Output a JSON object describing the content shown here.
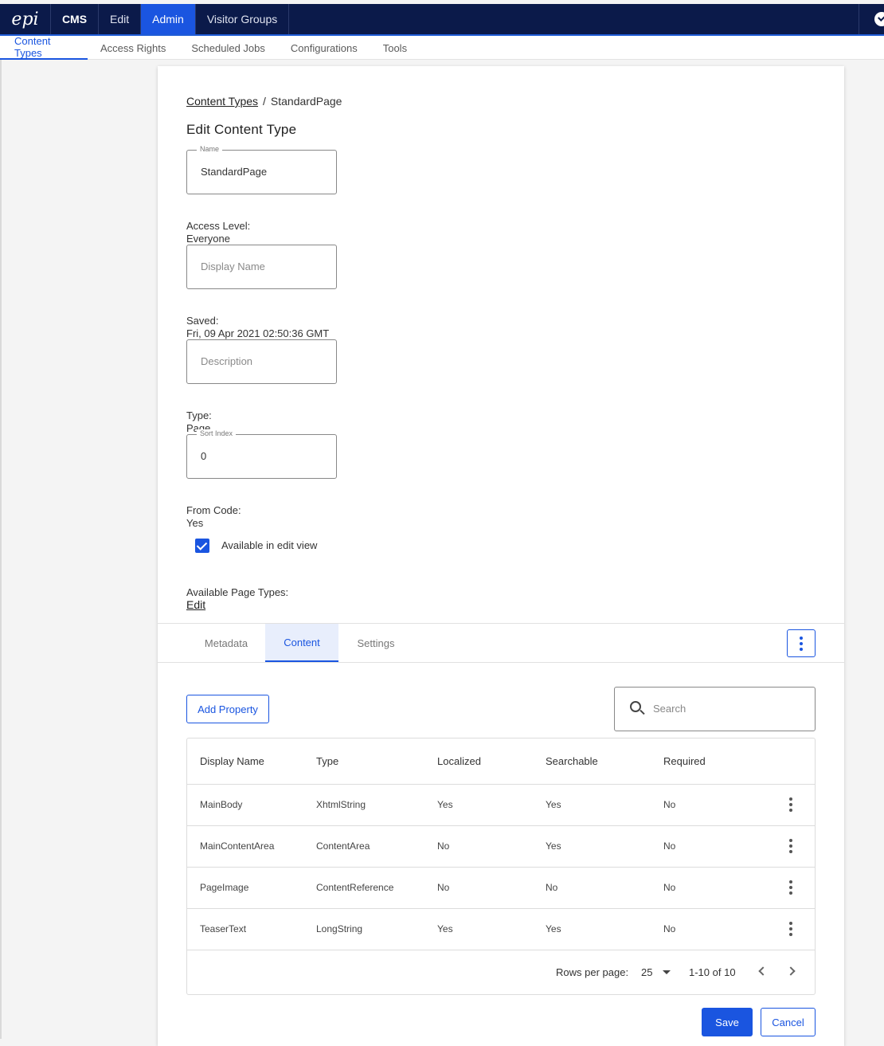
{
  "topbar": {
    "logo_text": "epi",
    "product": "CMS",
    "nav": [
      "Edit",
      "Admin",
      "Visitor Groups"
    ],
    "active": "Admin",
    "accent": "#1a55e0",
    "bg": "#0b1a4a"
  },
  "subnav": {
    "items": [
      "Content Types",
      "Access Rights",
      "Scheduled Jobs",
      "Configurations",
      "Tools"
    ],
    "active": "Content Types"
  },
  "breadcrumb": {
    "parent": "Content Types",
    "sep": "/",
    "current": "StandardPage"
  },
  "page_title": "Edit Content Type",
  "form": {
    "name_label": "Name",
    "name_value": "StandardPage",
    "access_label": "Access Level:",
    "access_value": "Everyone",
    "display_name_placeholder": "Display Name",
    "saved_label": "Saved:",
    "saved_value": "Fri, 09 Apr 2021 02:50:36 GMT",
    "description_placeholder": "Description",
    "type_label": "Type:",
    "type_value": "Page",
    "sort_label": "Sort Index",
    "sort_value": "0",
    "fromcode_label": "From Code:",
    "fromcode_value": "Yes",
    "available_edit_label": "Available in edit view",
    "available_edit_checked": true,
    "page_types_label": "Available Page Types:",
    "page_types_link": "Edit"
  },
  "tabs": {
    "items": [
      "Metadata",
      "Content",
      "Settings"
    ],
    "active": "Content"
  },
  "content": {
    "add_property": "Add Property",
    "search_placeholder": "Search",
    "columns": [
      "Display Name",
      "Type",
      "Localized",
      "Searchable",
      "Required"
    ],
    "rows": [
      [
        "MainBody",
        "XhtmlString",
        "Yes",
        "Yes",
        "No"
      ],
      [
        "MainContentArea",
        "ContentArea",
        "No",
        "Yes",
        "No"
      ],
      [
        "PageImage",
        "ContentReference",
        "No",
        "No",
        "No"
      ],
      [
        "TeaserText",
        "LongString",
        "Yes",
        "Yes",
        "No"
      ]
    ],
    "pager": {
      "rows_per_page_label": "Rows per page:",
      "rows_per_page": "25",
      "range": "1-10 of 10"
    }
  },
  "actions": {
    "save": "Save",
    "cancel": "Cancel"
  }
}
